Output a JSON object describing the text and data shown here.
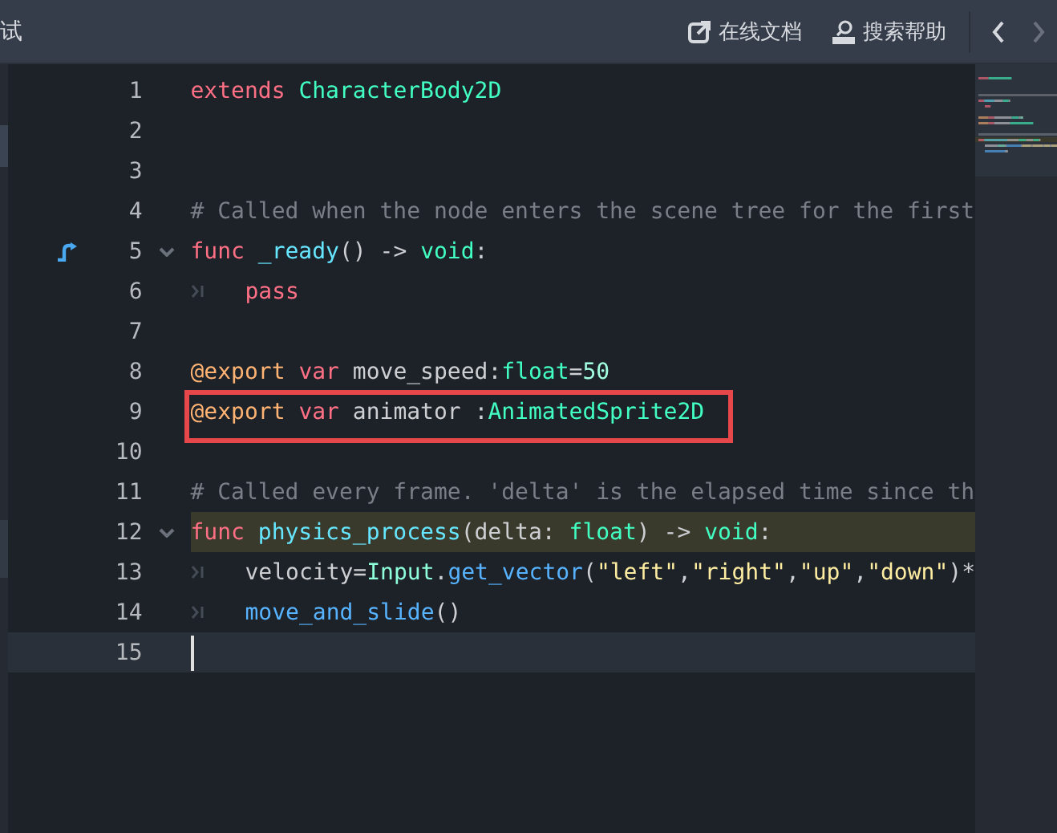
{
  "toolbar": {
    "left_label": "试",
    "buttons": [
      {
        "label": "在线文档"
      },
      {
        "label": "搜索帮助"
      }
    ],
    "nav": [
      {
        "disabled": false
      },
      {
        "disabled": true
      }
    ]
  },
  "editor": {
    "lines": [
      {
        "number": "1",
        "segments": [
          {
            "kind": "keyword",
            "text": "extends"
          },
          {
            "kind": "type",
            "text": " CharacterBody2D"
          }
        ]
      },
      {
        "number": "2"
      },
      {
        "number": "3"
      },
      {
        "number": "4",
        "segments": [
          {
            "kind": "comment",
            "text": "# Called when the node enters the scene tree for the first"
          }
        ]
      },
      {
        "number": "5",
        "override_marker": true,
        "foldable": true,
        "segments": [
          {
            "kind": "keyword",
            "text": "func"
          },
          {
            "kind": "funcdef",
            "text": " _ready"
          },
          {
            "kind": "plain",
            "text": "() -> "
          },
          {
            "kind": "type",
            "text": "void"
          },
          {
            "kind": "plain",
            "text": ":"
          }
        ]
      },
      {
        "number": "6",
        "indented": true,
        "segments": [
          {
            "kind": "keyword",
            "text": "pass"
          }
        ]
      },
      {
        "number": "7"
      },
      {
        "number": "8",
        "segments": [
          {
            "kind": "annotation",
            "text": "@export"
          },
          {
            "kind": "keyword",
            "text": " var"
          },
          {
            "kind": "plain",
            "text": " move_speed:"
          },
          {
            "kind": "type",
            "text": "float"
          },
          {
            "kind": "plain",
            "text": "="
          },
          {
            "kind": "number",
            "text": "50"
          }
        ]
      },
      {
        "number": "9",
        "boxed": true,
        "segments": [
          {
            "kind": "annotation",
            "text": "@export"
          },
          {
            "kind": "keyword",
            "text": " var"
          },
          {
            "kind": "plain",
            "text": " animator :"
          },
          {
            "kind": "type",
            "text": "AnimatedSprite2D"
          }
        ]
      },
      {
        "number": "10"
      },
      {
        "number": "11",
        "segments": [
          {
            "kind": "comment",
            "text": "# Called every frame. 'delta' is the elapsed time since th"
          }
        ]
      },
      {
        "number": "12",
        "foldable": true,
        "highlighted": true,
        "segments": [
          {
            "kind": "keyword",
            "text": "func"
          },
          {
            "kind": "funcdef",
            "text": " physics_process"
          },
          {
            "kind": "plain",
            "text": "(delta: "
          },
          {
            "kind": "type",
            "text": "float"
          },
          {
            "kind": "plain",
            "text": ") -> "
          },
          {
            "kind": "type",
            "text": "void"
          },
          {
            "kind": "plain",
            "text": ":"
          }
        ]
      },
      {
        "number": "13",
        "indented": true,
        "segments": [
          {
            "kind": "plain",
            "text": "velocity="
          },
          {
            "kind": "class",
            "text": "Input"
          },
          {
            "kind": "plain",
            "text": "."
          },
          {
            "kind": "call",
            "text": "get_vector"
          },
          {
            "kind": "plain",
            "text": "("
          },
          {
            "kind": "string",
            "text": "\"left\""
          },
          {
            "kind": "plain",
            "text": ","
          },
          {
            "kind": "string",
            "text": "\"right\""
          },
          {
            "kind": "plain",
            "text": ","
          },
          {
            "kind": "string",
            "text": "\"up\""
          },
          {
            "kind": "plain",
            "text": ","
          },
          {
            "kind": "string",
            "text": "\"down\""
          },
          {
            "kind": "plain",
            "text": ")*"
          }
        ]
      },
      {
        "number": "14",
        "indented": true,
        "segments": [
          {
            "kind": "call",
            "text": "move_and_slide"
          },
          {
            "kind": "plain",
            "text": "()"
          }
        ]
      },
      {
        "number": "15",
        "current": true
      }
    ]
  }
}
